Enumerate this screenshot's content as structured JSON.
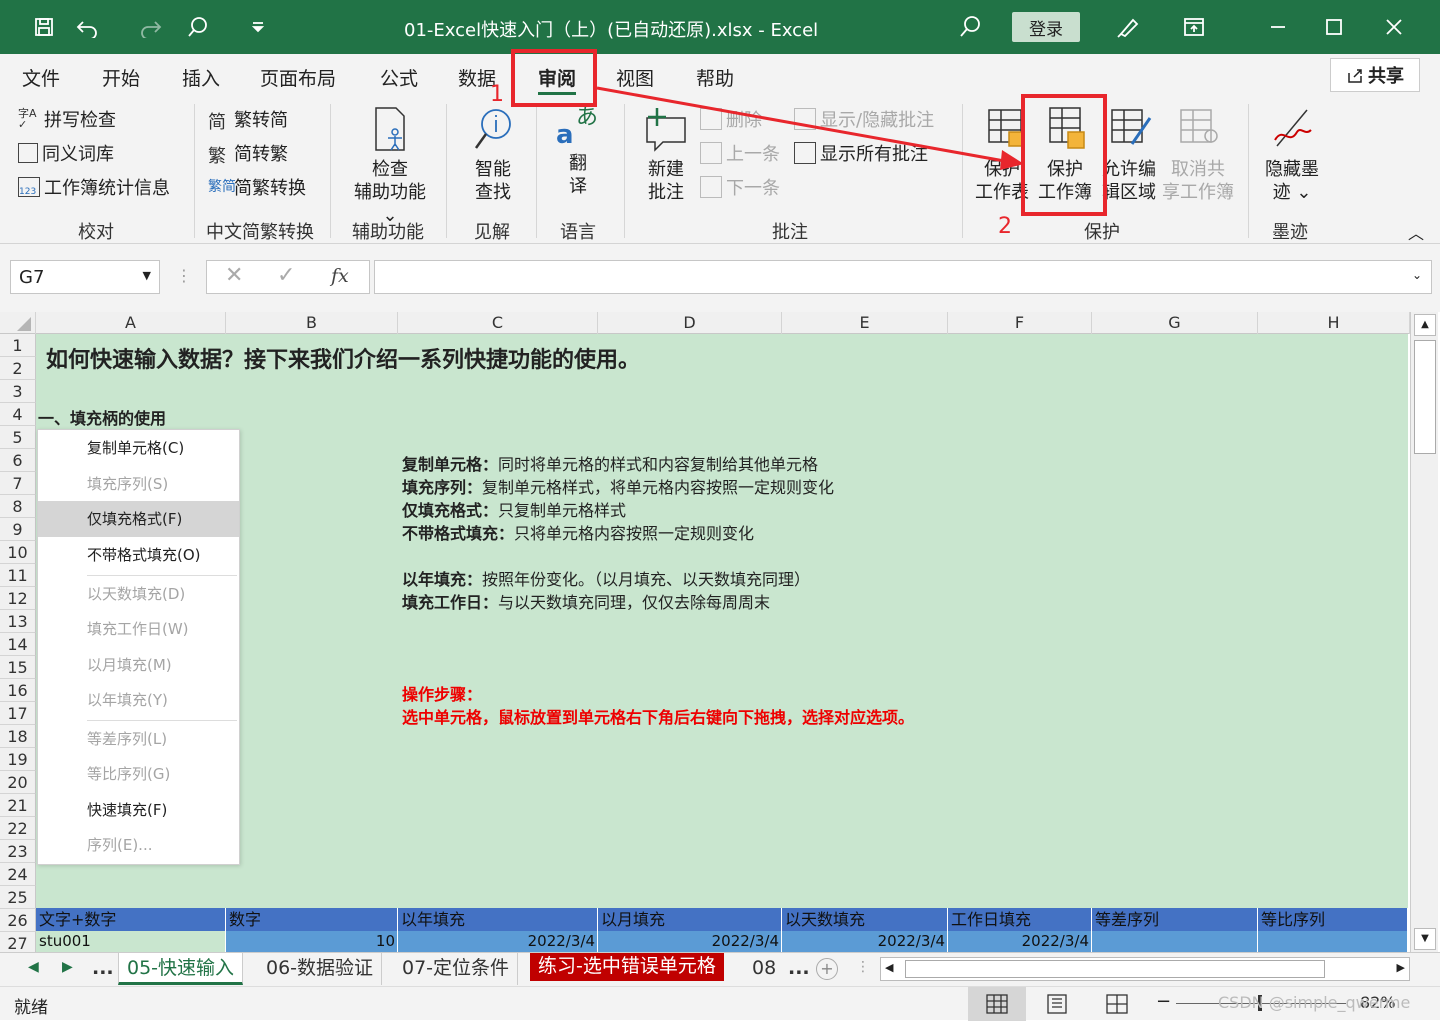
{
  "title_bar": {
    "title": "01-Excel快速入门（上）(已自动还原).xlsx  -  Excel",
    "login_label": "登录",
    "icons": [
      "save-icon",
      "undo-icon",
      "redo-icon",
      "search-icon",
      "customize-icon",
      "lightbulb-icon",
      "display-options-icon",
      "minimize-icon",
      "maximize-icon",
      "close-icon"
    ]
  },
  "menu": {
    "tabs": [
      "文件",
      "开始",
      "插入",
      "页面布局",
      "公式",
      "数据",
      "审阅",
      "视图",
      "帮助"
    ],
    "active": "审阅",
    "share_label": "共享"
  },
  "ribbon": {
    "proofing": {
      "items": [
        "拼写检查",
        "同义词库",
        "工作簿统计信息"
      ],
      "label": "校对"
    },
    "chinese": {
      "items": [
        "繁转简",
        "简转繁",
        "简繁转换"
      ],
      "label": "中文简繁转换"
    },
    "accessibility": {
      "line1": "检查",
      "line2": "辅助功能",
      "label": "辅助功能"
    },
    "insights": {
      "line1": "智能",
      "line2": "查找",
      "label": "见解"
    },
    "language": {
      "line1": "翻",
      "line2": "译",
      "label": "语言"
    },
    "comments": {
      "new_line1": "新建",
      "new_line2": "批注",
      "delete": "删除",
      "prev": "上一条",
      "next": "下一条",
      "toggle": "显示/隐藏批注",
      "show_all": "显示所有批注",
      "label": "批注"
    },
    "protect": {
      "sheet_line1": "保护",
      "sheet_line2": "工作表",
      "wb_line1": "保护",
      "wb_line2": "工作簿",
      "allow_line1": "允许编",
      "allow_line2": "辑区域",
      "unshare_line1": "取消共",
      "unshare_line2": "享工作簿",
      "label": "保护"
    },
    "ink": {
      "line1": "隐藏墨",
      "line2": "迹",
      "label": "墨迹"
    }
  },
  "annotations": {
    "step1": "1",
    "step2": "2",
    "arrow_color": "#e8262c"
  },
  "formula_bar": {
    "name_box": "G7",
    "fx": "fx",
    "value": ""
  },
  "grid": {
    "columns": [
      "A",
      "B",
      "C",
      "D",
      "E",
      "F",
      "G",
      "H"
    ],
    "rows": [
      "1",
      "2",
      "3",
      "4",
      "5",
      "6",
      "7",
      "8",
      "9",
      "10",
      "11",
      "12",
      "13",
      "14",
      "15",
      "16",
      "17",
      "18",
      "19",
      "20",
      "21",
      "22",
      "23",
      "24",
      "25",
      "26",
      "27"
    ],
    "heading": "如何快速输入数据？接下来我们介绍一系列快捷功能的使用。",
    "section": "一、填充柄的使用",
    "descriptions": [
      {
        "term": "复制单元格：",
        "text": "同时将单元格的样式和内容复制给其他单元格"
      },
      {
        "term": "填充序列：",
        "text": "复制单元格样式，将单元格内容按照一定规则变化"
      },
      {
        "term": "仅填充格式：",
        "text": "只复制单元格样式"
      },
      {
        "term": "不带格式填充：",
        "text": "只将单元格内容按照一定规则变化"
      },
      {
        "term": "以年填充：",
        "text": "按照年份变化。（以月填充、以天数填充同理）"
      },
      {
        "term": "填充工作日：",
        "text": "与以天数填充同理，仅仅去除每周周末"
      }
    ],
    "steps_title": "操作步骤：",
    "steps_text": "选中单元格，鼠标放置到单元格右下角后右键向下拖拽，选择对应选项。",
    "context_menu": [
      {
        "label": "复制单元格(C)",
        "state": "enabled"
      },
      {
        "label": "填充序列(S)",
        "state": "disabled"
      },
      {
        "label": "仅填充格式(F)",
        "state": "highlighted"
      },
      {
        "label": "不带格式填充(O)",
        "state": "enabled"
      },
      {
        "label": "以天数填充(D)",
        "state": "disabled"
      },
      {
        "label": "填充工作日(W)",
        "state": "disabled"
      },
      {
        "label": "以月填充(M)",
        "state": "disabled"
      },
      {
        "label": "以年填充(Y)",
        "state": "disabled"
      },
      {
        "label": "等差序列(L)",
        "state": "disabled"
      },
      {
        "label": "等比序列(G)",
        "state": "disabled"
      },
      {
        "label": "快速填充(F)",
        "state": "enabled"
      },
      {
        "label": "序列(E)...",
        "state": "disabled"
      }
    ],
    "table_headers": [
      "文字+数字",
      "数字",
      "以年填充",
      "以月填充",
      "以天数填充",
      "工作日填充",
      "等差序列",
      "等比序列"
    ],
    "row27": [
      "stu001",
      "10",
      "2022/3/4",
      "2022/3/4",
      "2022/3/4",
      "2022/3/4",
      "",
      ""
    ]
  },
  "sheet_tabs": {
    "tabs": [
      "...",
      "05-快速输入",
      "06-数据验证",
      "07-定位条件",
      "练习-选中错误单元格",
      "08",
      "..."
    ],
    "active": "05-快速输入",
    "exercise_color": "#c00000"
  },
  "status_bar": {
    "status": "就绪",
    "zoom": "82%",
    "watermark": "CSDN @simple_qwerme"
  }
}
